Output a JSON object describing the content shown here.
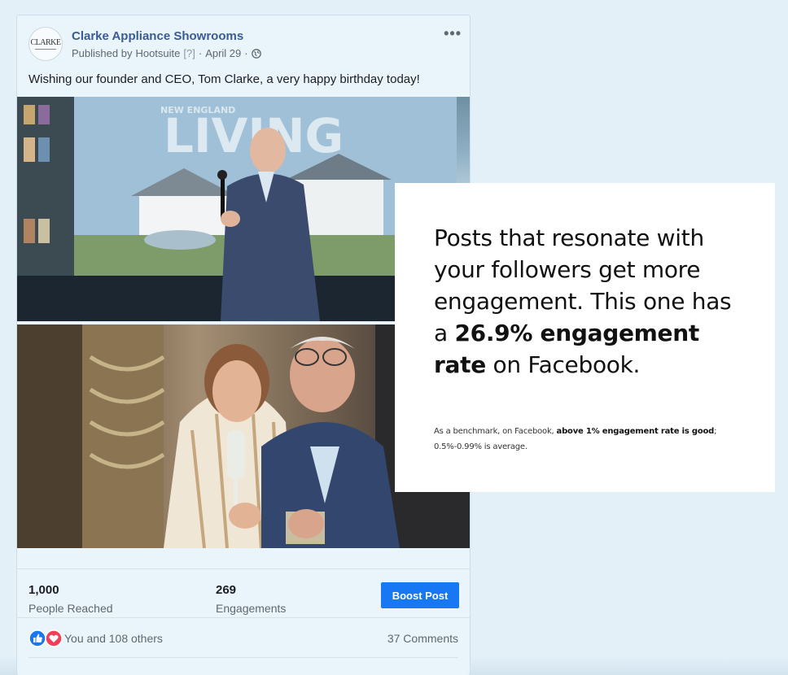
{
  "post": {
    "page_name": "Clarke Appliance Showrooms",
    "avatar_text": "CLARKE",
    "published_by_label": "Published by",
    "publisher": "Hootsuite",
    "publisher_help": "[?]",
    "date": "April 29",
    "separator": "·",
    "privacy_icon": "globe-icon",
    "more_icon": "more-dots-icon",
    "text": "Wishing our founder and CEO, Tom Clarke, a very happy birthday today!",
    "photo1_caption": "NEW ENGLAND LIVING"
  },
  "stats": {
    "reached_value": "1,000",
    "reached_label": "People Reached",
    "engagements_value": "269",
    "engagements_label": "Engagements",
    "boost_label": "Boost Post"
  },
  "reactions": {
    "icons": [
      "like-icon",
      "love-icon"
    ],
    "summary": "You and 108 others",
    "comments": "37 Comments"
  },
  "callout": {
    "main_pre": "Posts that resonate with your followers get more engagement. This one has a ",
    "main_bold": "26.9% engagement rate",
    "main_post": " on Facebook.",
    "note_pre": "As a benchmark, on Facebook, ",
    "note_bold": "above 1% engagement rate is good",
    "note_post": "; 0.5%-0.99% is average."
  },
  "colors": {
    "page_bg": "#e3f0f8",
    "link_blue": "#3a5b94",
    "boost_blue": "#1877f2",
    "like_blue": "#1877f2",
    "love_red": "#f33e58"
  }
}
